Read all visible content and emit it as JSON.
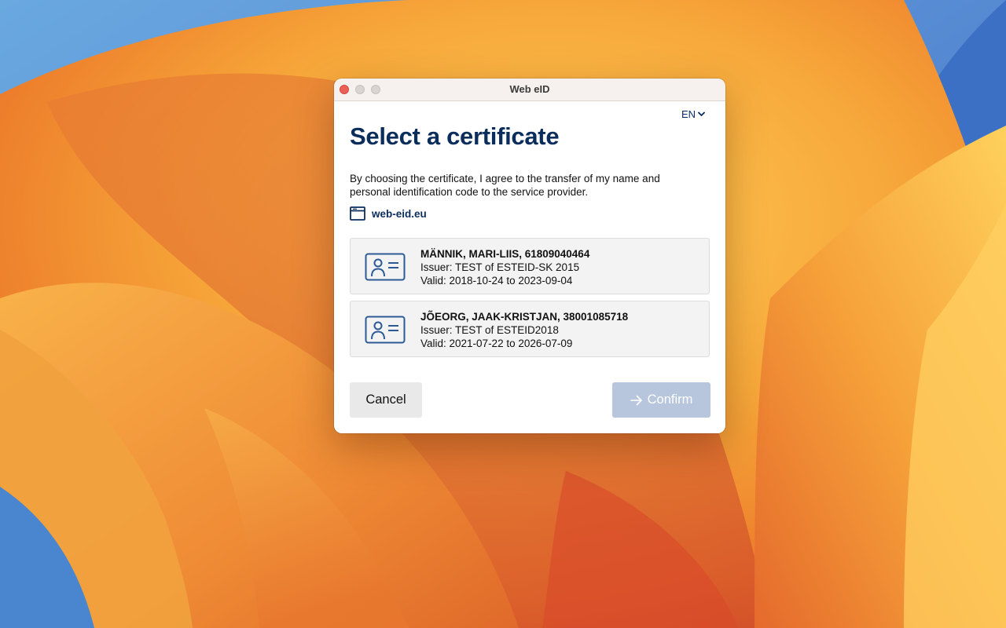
{
  "window": {
    "title": "Web eID"
  },
  "language": {
    "selected": "EN"
  },
  "page": {
    "heading": "Select a certificate",
    "description": "By choosing the certificate, I agree to the transfer of my name and personal identification code to the service provider.",
    "origin": "web-eid.eu"
  },
  "certificates": [
    {
      "name": "MÄNNIK, MARI-LIIS, 61809040464",
      "issuer": "Issuer: TEST of ESTEID-SK 2015",
      "validity": "Valid: 2018-10-24 to 2023-09-04"
    },
    {
      "name": "JÕEORG, JAAK-KRISTJAN, 38001085718",
      "issuer": "Issuer: TEST of ESTEID2018",
      "validity": "Valid: 2021-07-22 to 2026-07-09"
    }
  ],
  "buttons": {
    "cancel_label": "Cancel",
    "confirm_label": "Confirm"
  },
  "colors": {
    "brand_navy": "#0b2d5c",
    "confirm_disabled": "#b7c6dd",
    "close_button": "#ec5f56"
  },
  "icons": {
    "language_chevron": "chevron-down-icon",
    "origin": "browser-window-icon",
    "certificate": "id-card-icon",
    "confirm": "arrow-right-icon"
  }
}
